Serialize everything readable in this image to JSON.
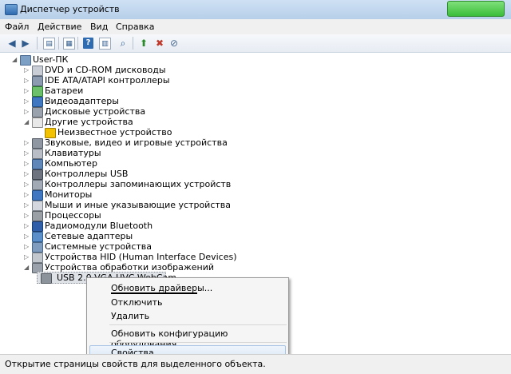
{
  "window": {
    "title": "Диспетчер устройств"
  },
  "menu": [
    "Файл",
    "Действие",
    "Вид",
    "Справка"
  ],
  "tree": {
    "root": "User-ПК",
    "items": [
      {
        "label": "DVD и CD-ROM дисководы",
        "icon": "dvd-drive-icon"
      },
      {
        "label": "IDE ATA/ATAPI контроллеры",
        "icon": "ide-controller-icon"
      },
      {
        "label": "Батареи",
        "icon": "battery-icon"
      },
      {
        "label": "Видеоадаптеры",
        "icon": "display-adapter-icon"
      },
      {
        "label": "Дисковые устройства",
        "icon": "disk-drive-icon"
      },
      {
        "label": "Другие устройства",
        "icon": "other-devices-icon"
      },
      {
        "label": "Неизвестное устройство",
        "icon": "unknown-device-warning-icon"
      },
      {
        "label": "Звуковые, видео и игровые устройства",
        "icon": "sound-icon"
      },
      {
        "label": "Клавиатуры",
        "icon": "keyboard-icon"
      },
      {
        "label": "Компьютер",
        "icon": "computer-icon"
      },
      {
        "label": "Контроллеры USB",
        "icon": "usb-icon"
      },
      {
        "label": "Контроллеры запоминающих устройств",
        "icon": "storage-controller-icon"
      },
      {
        "label": "Мониторы",
        "icon": "monitor-icon"
      },
      {
        "label": "Мыши и иные указывающие устройства",
        "icon": "mouse-icon"
      },
      {
        "label": "Процессоры",
        "icon": "processor-icon"
      },
      {
        "label": "Радиомодули Bluetooth",
        "icon": "bluetooth-icon"
      },
      {
        "label": "Сетевые адаптеры",
        "icon": "network-adapter-icon"
      },
      {
        "label": "Системные устройства",
        "icon": "system-device-icon"
      },
      {
        "label": "Устройства HID (Human Interface Devices)",
        "icon": "hid-icon"
      },
      {
        "label": "Устройства обработки изображений",
        "icon": "imaging-device-icon"
      },
      {
        "label": "USB 2.0 VGA UVC WebCam",
        "icon": "webcam-icon"
      }
    ]
  },
  "context_menu": {
    "update_drivers": "Обновить драйверы...",
    "disable": "Отключить",
    "uninstall": "Удалить",
    "scan_hardware": "Обновить конфигурацию оборудования",
    "properties": "Свойства"
  },
  "status_bar": {
    "text": "Открытие страницы свойств для выделенного объекта."
  },
  "colors": {
    "title_bar": "#c5daf0",
    "selection": "#dce8f6",
    "warning": "#f2c200"
  }
}
